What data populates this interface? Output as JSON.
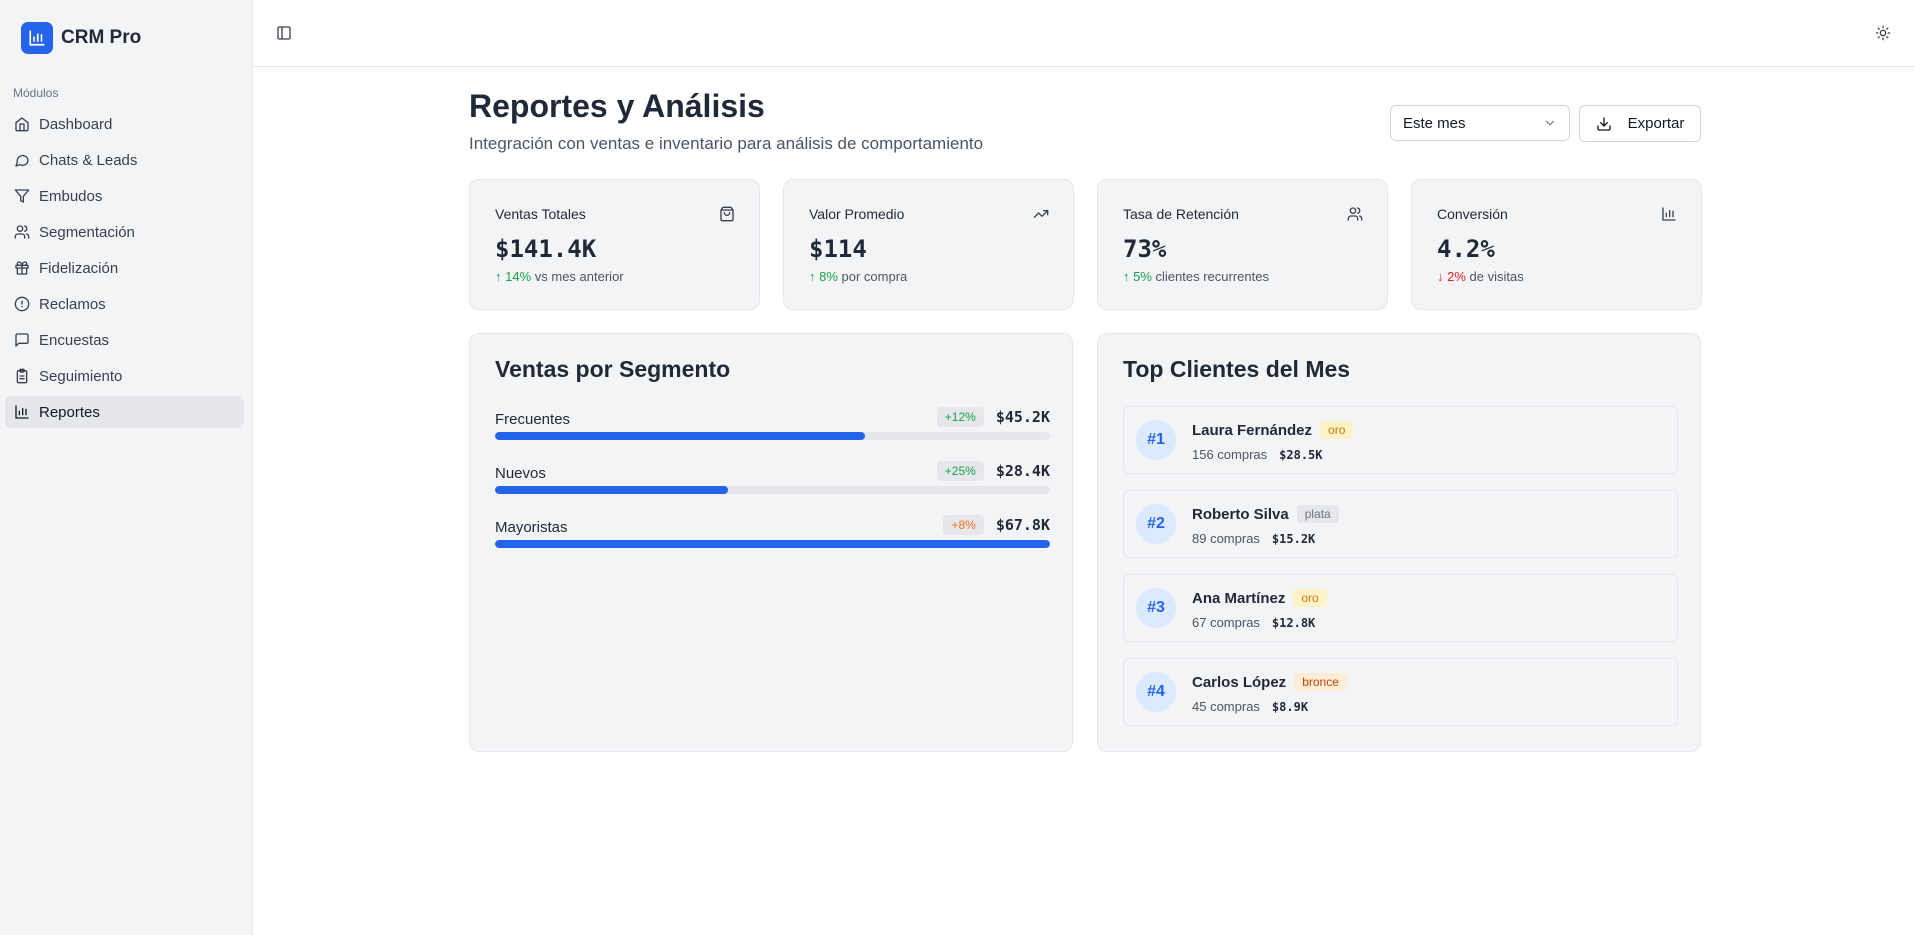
{
  "brand": {
    "name": "CRM Pro"
  },
  "sidebar": {
    "section_label": "Módulos",
    "items": [
      {
        "label": "Dashboard",
        "icon": "home-icon"
      },
      {
        "label": "Chats & Leads",
        "icon": "chat-icon"
      },
      {
        "label": "Embudos",
        "icon": "filter-icon"
      },
      {
        "label": "Segmentación",
        "icon": "users-icon"
      },
      {
        "label": "Fidelización",
        "icon": "gift-icon"
      },
      {
        "label": "Reclamos",
        "icon": "alert-circle-icon"
      },
      {
        "label": "Encuestas",
        "icon": "message-square-icon"
      },
      {
        "label": "Seguimiento",
        "icon": "clipboard-icon"
      },
      {
        "label": "Reportes",
        "icon": "bar-chart-icon",
        "active": true
      }
    ]
  },
  "header": {
    "title": "Reportes y Análisis",
    "subtitle": "Integración con ventas e inventario para análisis de comportamiento",
    "period": "Este mes",
    "export_label": "Exportar"
  },
  "stats": [
    {
      "label": "Ventas Totales",
      "value": "$141.4K",
      "change": "↑ 14%",
      "change_dir": "up",
      "suffix": "vs mes anterior",
      "icon": "shopping-bag-icon"
    },
    {
      "label": "Valor Promedio",
      "value": "$114",
      "change": "↑ 8%",
      "change_dir": "up",
      "suffix": "por compra",
      "icon": "trending-up-icon"
    },
    {
      "label": "Tasa de Retención",
      "value": "73%",
      "change": "↑ 5%",
      "change_dir": "up",
      "suffix": "clientes recurrentes",
      "icon": "users-icon"
    },
    {
      "label": "Conversión",
      "value": "4.2%",
      "change": "↓ 2%",
      "change_dir": "down",
      "suffix": "de visitas",
      "icon": "bar-chart-icon"
    }
  ],
  "segments": {
    "title": "Ventas por Segmento",
    "items": [
      {
        "name": "Frecuentes",
        "badge": "+12%",
        "badge_color": "#16a34a",
        "amount": "$45.2K",
        "fraction": 0.667
      },
      {
        "name": "Nuevos",
        "badge": "+25%",
        "badge_color": "#16a34a",
        "amount": "$28.4K",
        "fraction": 0.419
      },
      {
        "name": "Mayoristas",
        "badge": "+8%",
        "badge_color": "#f97316",
        "amount": "$67.8K",
        "fraction": 1.0
      }
    ]
  },
  "top_clients": {
    "title": "Top Clientes del Mes",
    "items": [
      {
        "rank": "#1",
        "name": "Laura Fernández",
        "tier": "oro",
        "purchases": "156 compras",
        "amount": "$28.5K"
      },
      {
        "rank": "#2",
        "name": "Roberto Silva",
        "tier": "plata",
        "purchases": "89 compras",
        "amount": "$15.2K"
      },
      {
        "rank": "#3",
        "name": "Ana Martínez",
        "tier": "oro",
        "purchases": "67 compras",
        "amount": "$12.8K"
      },
      {
        "rank": "#4",
        "name": "Carlos López",
        "tier": "bronce",
        "purchases": "45 compras",
        "amount": "$8.9K"
      }
    ]
  },
  "colors": {
    "accent": "#2563eb",
    "positive": "#16a34a",
    "negative": "#dc2626",
    "warning": "#f97316"
  }
}
